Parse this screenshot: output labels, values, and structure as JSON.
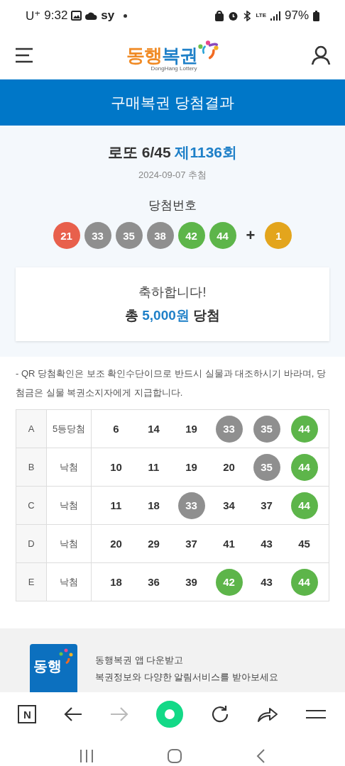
{
  "status_bar": {
    "carrier": "U⁺",
    "time": "9:32",
    "app_label": "sy",
    "network": "LTE",
    "battery": "97%"
  },
  "header": {
    "logo_text": "동행복권",
    "logo_subtitle": "DongHang Lottery"
  },
  "banner": {
    "title": "구매복권 당첨결과"
  },
  "draw": {
    "game": "로또 6/45",
    "round": "제1136회",
    "date": "2024-09-07 추첨",
    "numbers_label": "당첨번호",
    "numbers": [
      {
        "value": "21",
        "color": "#e8604c"
      },
      {
        "value": "33",
        "color": "#8f8f8f"
      },
      {
        "value": "35",
        "color": "#8f8f8f"
      },
      {
        "value": "38",
        "color": "#8f8f8f"
      },
      {
        "value": "42",
        "color": "#5db54a"
      },
      {
        "value": "44",
        "color": "#5db54a"
      }
    ],
    "plus": "+",
    "bonus": {
      "value": "1",
      "color": "#e3a51d"
    }
  },
  "prize": {
    "greeting": "축하합니다!",
    "prefix": "총",
    "amount": "5,000원",
    "suffix": "당첨"
  },
  "notice": "- QR 당첨확인은 보조 확인수단이므로 반드시 실물과 대조하시기 바라며, 당첨금은 실물 복권소지자에게 지급합니다.",
  "tickets": [
    {
      "game": "A",
      "result": "5등당첨",
      "numbers": [
        {
          "value": "6",
          "matched": false
        },
        {
          "value": "14",
          "matched": false
        },
        {
          "value": "19",
          "matched": false
        },
        {
          "value": "33",
          "matched": true,
          "color": "#8f8f8f"
        },
        {
          "value": "35",
          "matched": true,
          "color": "#8f8f8f"
        },
        {
          "value": "44",
          "matched": true,
          "color": "#5db54a"
        }
      ]
    },
    {
      "game": "B",
      "result": "낙첨",
      "numbers": [
        {
          "value": "10",
          "matched": false
        },
        {
          "value": "11",
          "matched": false
        },
        {
          "value": "19",
          "matched": false
        },
        {
          "value": "20",
          "matched": false
        },
        {
          "value": "35",
          "matched": true,
          "color": "#8f8f8f"
        },
        {
          "value": "44",
          "matched": true,
          "color": "#5db54a"
        }
      ]
    },
    {
      "game": "C",
      "result": "낙첨",
      "numbers": [
        {
          "value": "11",
          "matched": false
        },
        {
          "value": "18",
          "matched": false
        },
        {
          "value": "33",
          "matched": true,
          "color": "#8f8f8f"
        },
        {
          "value": "34",
          "matched": false
        },
        {
          "value": "37",
          "matched": false
        },
        {
          "value": "44",
          "matched": true,
          "color": "#5db54a"
        }
      ]
    },
    {
      "game": "D",
      "result": "낙첨",
      "numbers": [
        {
          "value": "20",
          "matched": false
        },
        {
          "value": "29",
          "matched": false
        },
        {
          "value": "37",
          "matched": false
        },
        {
          "value": "41",
          "matched": false
        },
        {
          "value": "43",
          "matched": false
        },
        {
          "value": "45",
          "matched": false
        }
      ]
    },
    {
      "game": "E",
      "result": "낙첨",
      "numbers": [
        {
          "value": "18",
          "matched": false
        },
        {
          "value": "36",
          "matched": false
        },
        {
          "value": "39",
          "matched": false
        },
        {
          "value": "42",
          "matched": true,
          "color": "#5db54a"
        },
        {
          "value": "43",
          "matched": false
        },
        {
          "value": "44",
          "matched": true,
          "color": "#5db54a"
        }
      ]
    }
  ],
  "promo": {
    "icon_text": "동행",
    "line1": "동행복권 앱 다운받고",
    "line2": "복권정보와 다양한 알림서비스를 받아보세요"
  },
  "browser_toolbar": {
    "home_label": "N",
    "forward": {
      "disabled": true
    }
  }
}
